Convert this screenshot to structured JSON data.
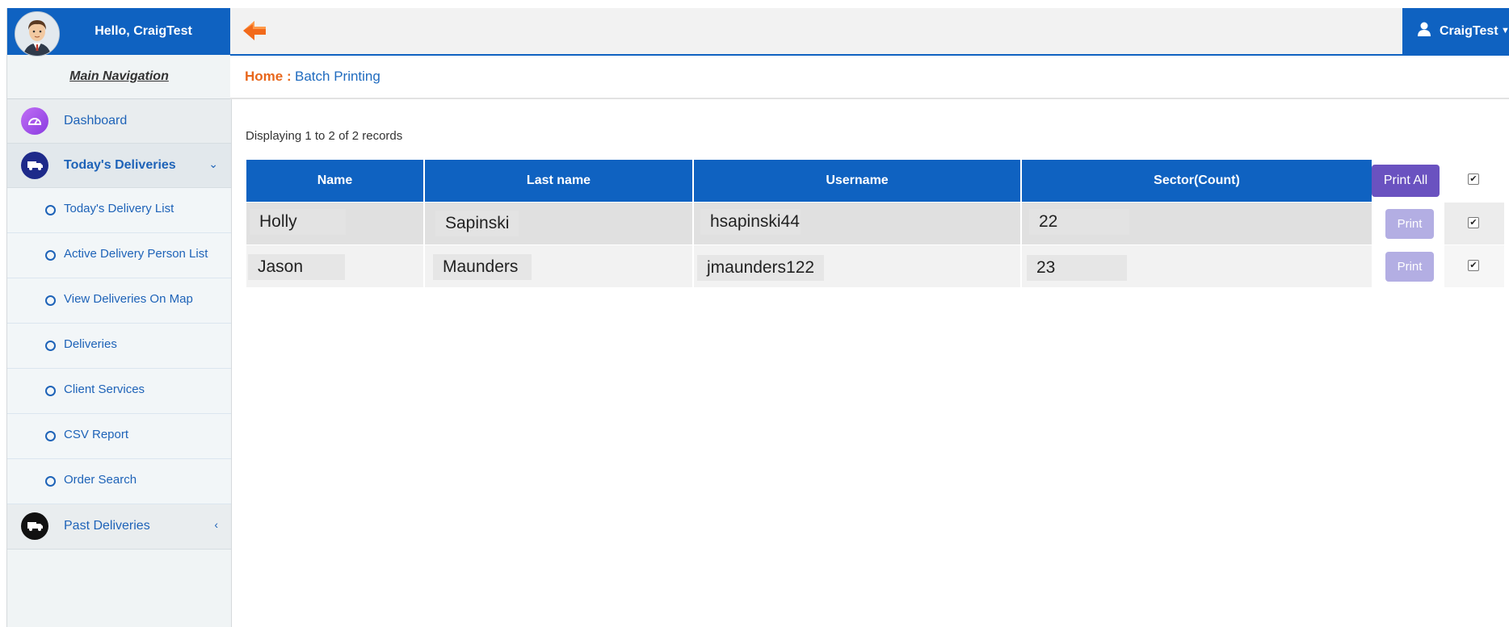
{
  "user": {
    "greeting": "Hello, CraigTest",
    "menu_name": "CraigTest"
  },
  "sidebar": {
    "title": "Main Navigation",
    "dashboard": "Dashboard",
    "todays_deliveries": "Today's Deliveries",
    "sub_items": [
      "Today's Delivery List",
      "Active Delivery Person List",
      "View Deliveries On Map",
      "Deliveries",
      "Client Services",
      "CSV Report",
      "Order Search"
    ],
    "past_deliveries": "Past Deliveries"
  },
  "breadcrumb": {
    "home": "Home :",
    "current": "Batch Printing"
  },
  "records_info": "Displaying 1 to 2 of 2 records",
  "table": {
    "headers": [
      "Name",
      "Last name",
      "Username",
      "Sector(Count)"
    ],
    "print_all_label": "Print All",
    "print_label": "Print",
    "rows": [
      {
        "name": "Holly",
        "last_name": "Sapinski",
        "username": "hsapinski44",
        "sector": "22",
        "checked": true
      },
      {
        "name": "Jason",
        "last_name": "Maunders",
        "username": "jmaunders122",
        "sector": "23",
        "checked": true
      }
    ],
    "header_checked": true
  },
  "colors": {
    "primary": "#0f62c1",
    "accent": "#e8671c",
    "print_all": "#6a52c0",
    "print_disabled": "#b3aee3"
  }
}
